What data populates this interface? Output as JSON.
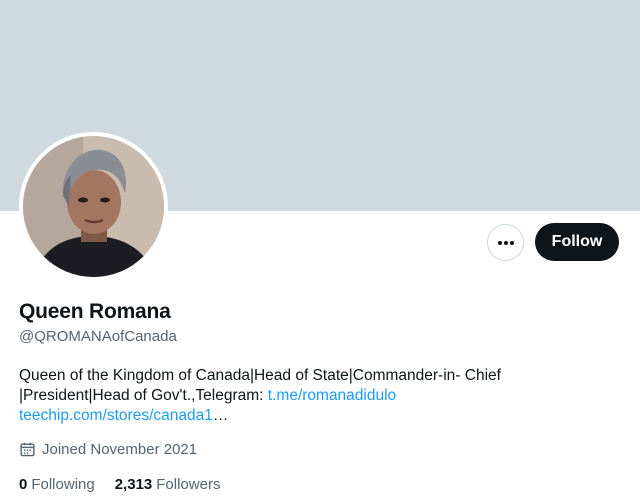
{
  "profile": {
    "name": "Queen Romana",
    "handle": "@QROMANAofCanada",
    "bio_line1": "Queen of the Kingdom of Canada|Head of State|Commander-in- Chief",
    "bio_line2_prefix": "|President|Head of Gov't.,Telegram: ",
    "bio_link1": "t.me/romanadidulo",
    "bio_link2": "teechip.com/stores/canada1",
    "bio_ellipsis": "…",
    "joined": "Joined November 2021",
    "following_count": "0",
    "following_label": "Following",
    "followers_count": "2,313",
    "followers_label": "Followers"
  },
  "actions": {
    "follow_label": "Follow",
    "more_icon": "more-horizontal-icon"
  },
  "colors": {
    "banner": "#cfd9de",
    "link": "#1d9bf0",
    "follow_bg": "#0f1419",
    "secondary_text": "#536471"
  }
}
